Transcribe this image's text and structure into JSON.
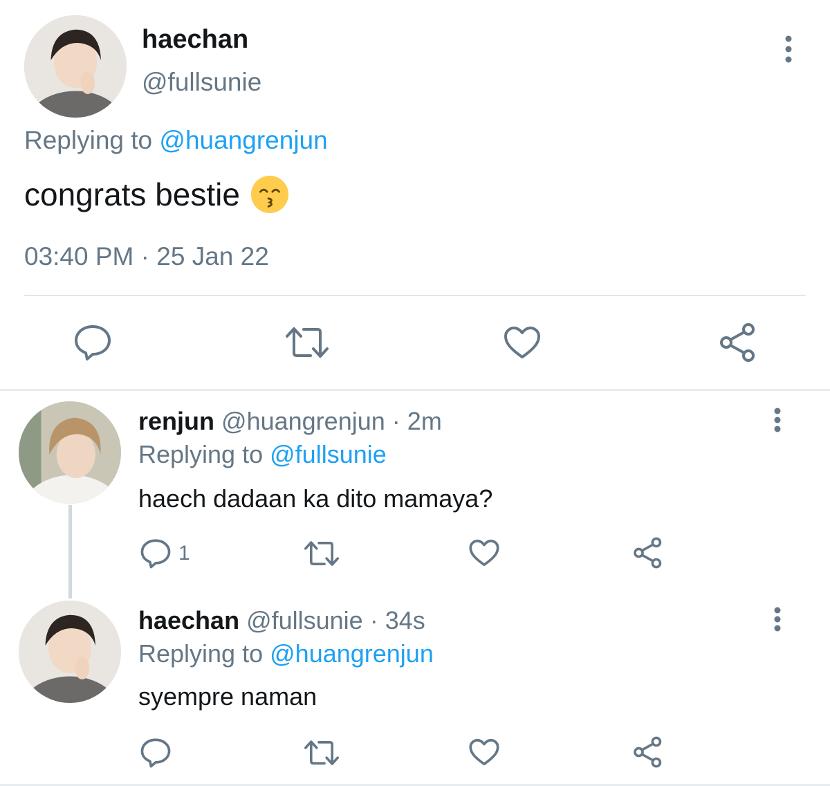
{
  "main_tweet": {
    "author_name": "haechan",
    "author_handle": "@fullsunie",
    "replying_prefix": "Replying to",
    "replying_handle": "@huangrenjun",
    "text": "congrats bestie",
    "emoji": "kissing-face-with-smiling-eyes",
    "time": "03:40 PM",
    "separator": "·",
    "date": "25 Jan 22",
    "actions": [
      "reply-icon",
      "retweet-icon",
      "like-icon",
      "share-icon"
    ]
  },
  "replies": [
    {
      "author_name": "renjun",
      "author_handle": "@huangrenjun",
      "separator": "·",
      "time_ago": "2m",
      "replying_prefix": "Replying to",
      "replying_handle": "@fullsunie",
      "text": "haech dadaan ka dito mamaya?",
      "reply_count": "1"
    },
    {
      "author_name": "haechan",
      "author_handle": "@fullsunie",
      "separator": "·",
      "time_ago": "34s",
      "replying_prefix": "Replying to",
      "replying_handle": "@huangrenjun",
      "text": "syempre naman",
      "reply_count": ""
    }
  ],
  "colors": {
    "primary_text": "#14171a",
    "secondary_text": "#657786",
    "link": "#1da1f2",
    "divider": "#e1e8ed"
  }
}
